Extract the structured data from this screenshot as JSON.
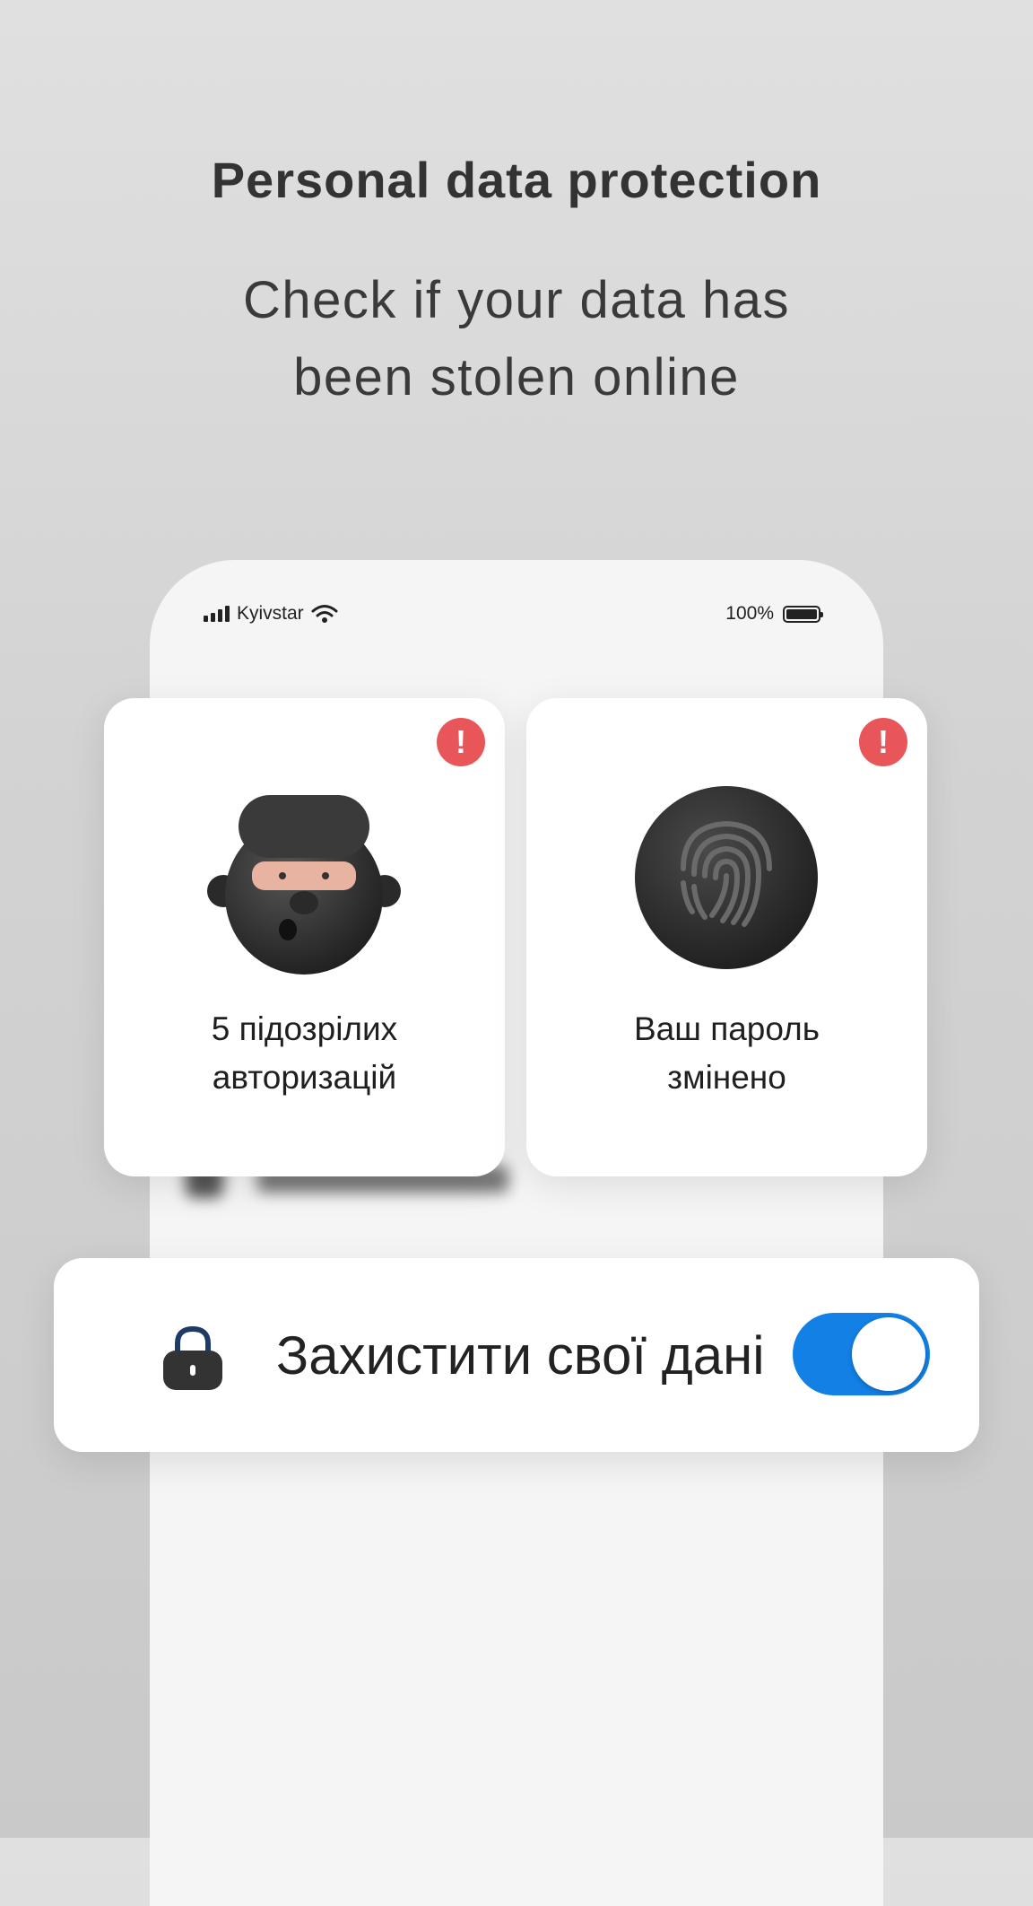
{
  "header": {
    "title": "Personal data protection",
    "subtitle_line1": "Check if your data has",
    "subtitle_line2": "been stolen online"
  },
  "status_bar": {
    "carrier": "Kyivstar",
    "battery": "100%"
  },
  "cards": [
    {
      "line1": "5 підозрілих",
      "line2": "авторизацій",
      "icon": "ninja-avatar-icon",
      "alert": "!"
    },
    {
      "line1": "Ваш пароль",
      "line2": "змінено",
      "icon": "fingerprint-icon",
      "alert": "!"
    }
  ],
  "protect_toggle": {
    "label": "Захистити свої дані",
    "checked": true,
    "accent": "#1380e6"
  },
  "colors": {
    "alert": "#e8565a"
  }
}
